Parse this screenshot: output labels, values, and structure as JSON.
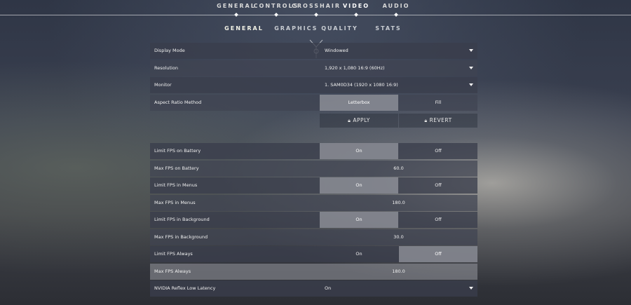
{
  "nav": {
    "tabs": [
      {
        "label": "GENERAL"
      },
      {
        "label": "CONTROLS"
      },
      {
        "label": "CROSSHAIR"
      },
      {
        "label": "VIDEO"
      },
      {
        "label": "AUDIO"
      }
    ],
    "active_tab": "VIDEO"
  },
  "subtabs": [
    {
      "label": "GENERAL"
    },
    {
      "label": "GRAPHICS QUALITY"
    },
    {
      "label": "STATS"
    }
  ],
  "active_subtab": "GENERAL",
  "settings": {
    "display_mode": {
      "label": "Display Mode",
      "value": "Windowed"
    },
    "resolution": {
      "label": "Resolution",
      "value": "1,920 x 1,080 16:9 (60Hz)"
    },
    "monitor": {
      "label": "Monitor",
      "value": "1. SAM0D34 (1920 x  1080 16:9)"
    },
    "aspect_ratio": {
      "label": "Aspect Ratio Method",
      "left": "Letterbox",
      "right": "Fill",
      "selected": "Letterbox"
    },
    "apply": {
      "label": "APPLY"
    },
    "revert": {
      "label": "REVERT"
    },
    "limit_fps_battery": {
      "label": "Limit FPS on Battery",
      "left": "On",
      "right": "Off",
      "selected": "On"
    },
    "max_fps_battery": {
      "label": "Max FPS on Battery",
      "value": "60.0"
    },
    "limit_fps_menus": {
      "label": "Limit FPS in Menus",
      "left": "On",
      "right": "Off",
      "selected": "On"
    },
    "max_fps_menus": {
      "label": "Max FPS in Menus",
      "value": "180.0"
    },
    "limit_fps_background": {
      "label": "Limit FPS in Background",
      "left": "On",
      "right": "Off",
      "selected": "On"
    },
    "max_fps_background": {
      "label": "Max FPS in Background",
      "value": "30.0"
    },
    "limit_fps_always": {
      "label": "Limit FPS Always",
      "left": "On",
      "right": "Off",
      "selected": "Off"
    },
    "max_fps_always": {
      "label": "Max FPS Always",
      "value": "180.0"
    },
    "nvidia_reflex": {
      "label": "NVIDIA Reflex Low Latency",
      "value": "On"
    }
  },
  "colors": {
    "row_bg": "#3a3e4c",
    "selected_bg": "#aaacb2",
    "text": "#f0f0f0",
    "nav_line": "#ffffff"
  },
  "icons": [
    "lock-icon",
    "caret-down-icon",
    "emblem-icon"
  ]
}
